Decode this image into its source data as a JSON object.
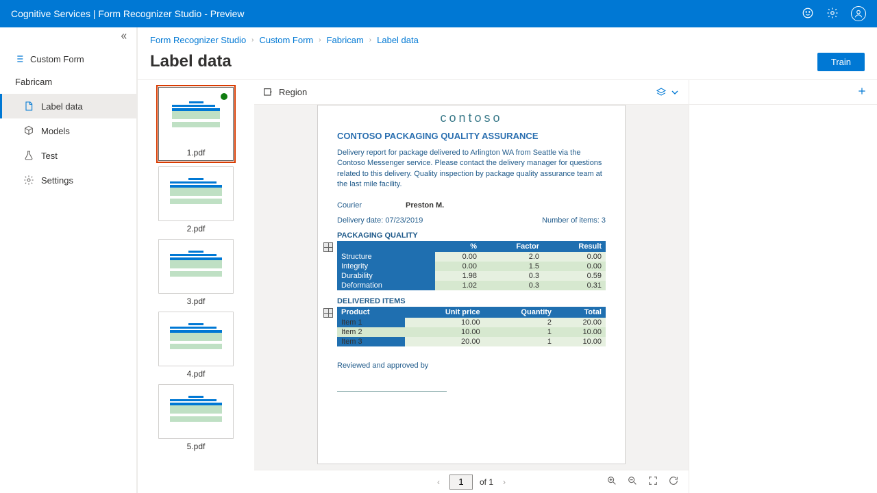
{
  "header": {
    "title": "Cognitive Services | Form Recognizer Studio - Preview"
  },
  "sidebar": {
    "section": "Custom Form",
    "project": "Fabricam",
    "items": [
      {
        "label": "Label data"
      },
      {
        "label": "Models"
      },
      {
        "label": "Test"
      },
      {
        "label": "Settings"
      }
    ]
  },
  "breadcrumb": [
    "Form Recognizer Studio",
    "Custom Form",
    "Fabricam",
    "Label data"
  ],
  "page": {
    "title": "Label data",
    "train_btn": "Train"
  },
  "toolbar": {
    "region": "Region"
  },
  "thumbnails": [
    {
      "label": "1.pdf",
      "selected": true,
      "done": true
    },
    {
      "label": "2.pdf"
    },
    {
      "label": "3.pdf"
    },
    {
      "label": "4.pdf"
    },
    {
      "label": "5.pdf"
    }
  ],
  "doc": {
    "brand": "contoso",
    "title": "CONTOSO PACKAGING QUALITY ASSURANCE",
    "desc": "Delivery report for package delivered to Arlington WA from Seattle via the Contoso Messenger service. Please contact the delivery manager for questions related to this delivery. Quality inspection by package quality assurance team at the last mile facility.",
    "courier_lbl": "Courier",
    "courier_val": "Preston M.",
    "date_lbl": "Delivery date:",
    "date_val": "07/23/2019",
    "items_lbl": "Number of items:",
    "items_val": "3",
    "pq_title": "PACKAGING QUALITY",
    "pq_headers": [
      "",
      "%",
      "Factor",
      "Result"
    ],
    "pq_rows": [
      [
        "Structure",
        "0.00",
        "2.0",
        "0.00"
      ],
      [
        "Integrity",
        "0.00",
        "1.5",
        "0.00"
      ],
      [
        "Durability",
        "1.98",
        "0.3",
        "0.59"
      ],
      [
        "Deformation",
        "1.02",
        "0.3",
        "0.31"
      ]
    ],
    "di_title": "DELIVERED ITEMS",
    "di_headers": [
      "Product",
      "Unit price",
      "Quantity",
      "Total"
    ],
    "di_rows": [
      [
        "Item 1",
        "10.00",
        "2",
        "20.00"
      ],
      [
        "Item 2",
        "10.00",
        "1",
        "10.00"
      ],
      [
        "Item 3",
        "20.00",
        "1",
        "10.00"
      ]
    ],
    "reviewed": "Reviewed and approved by"
  },
  "pager": {
    "page": "1",
    "of": "of 1"
  }
}
